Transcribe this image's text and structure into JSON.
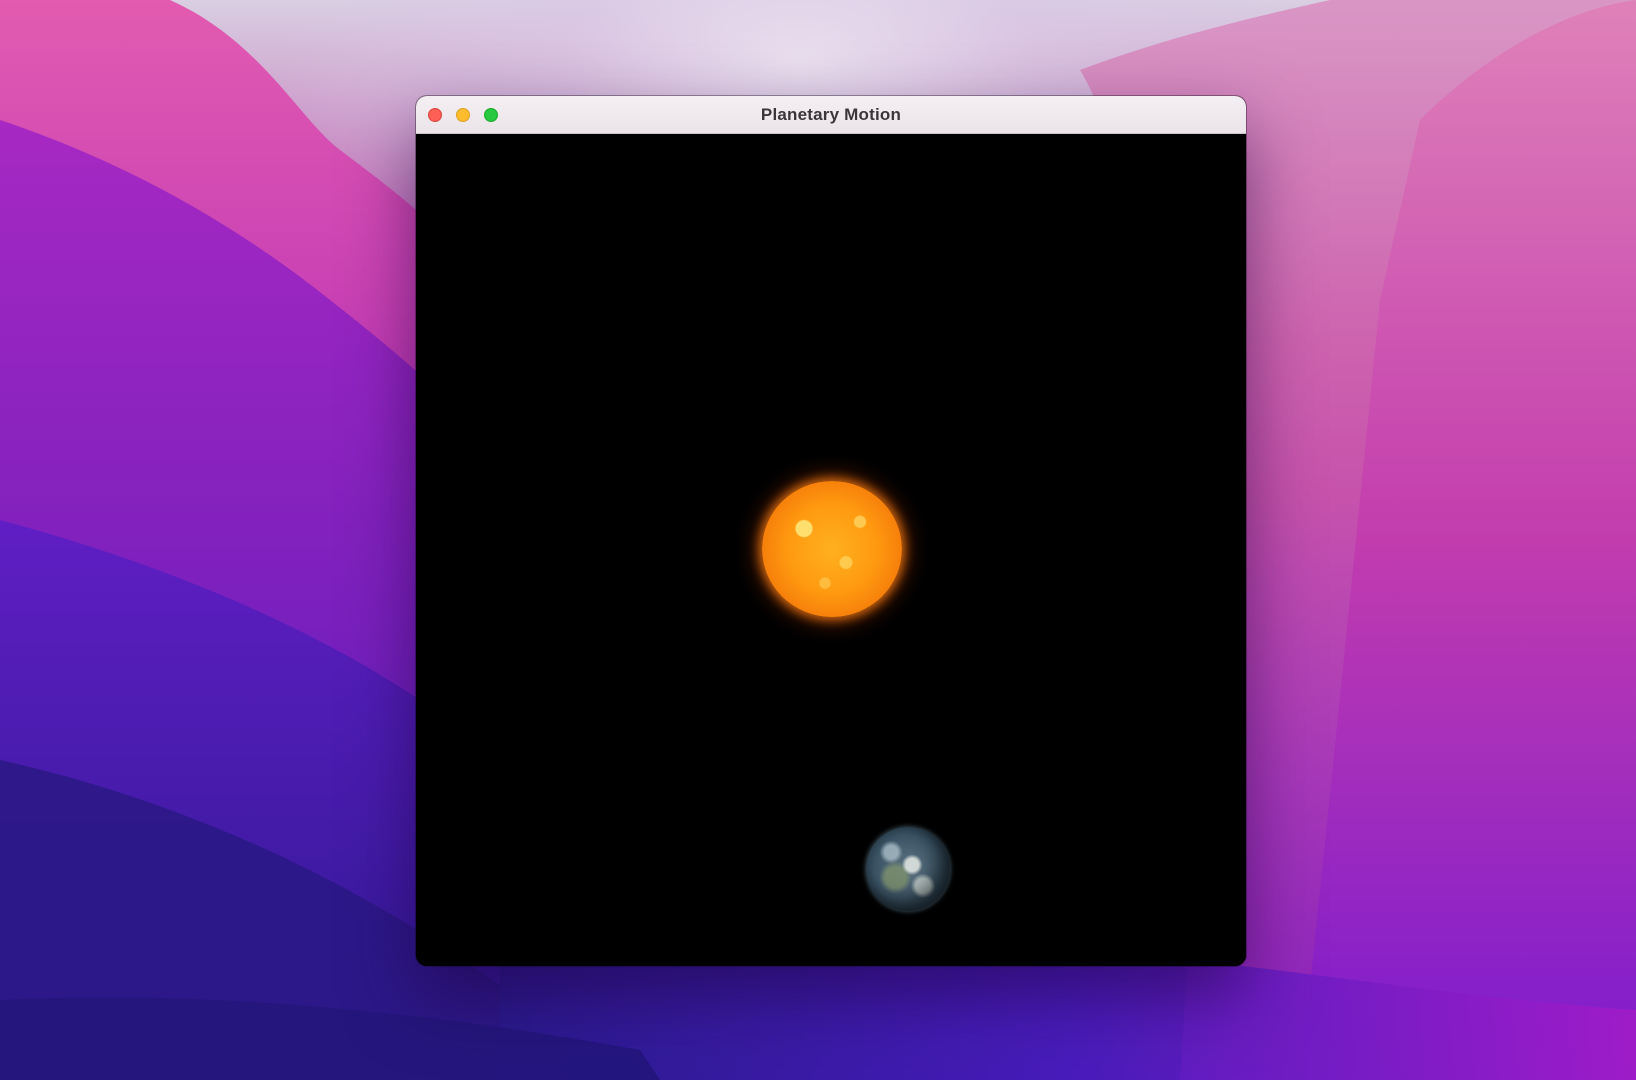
{
  "desktop": {
    "wallpaper": "macOS Monterey wallpaper"
  },
  "window": {
    "title": "Planetary Motion",
    "controls": {
      "close": "close-button",
      "minimize": "minimize-button",
      "zoom": "zoom-button"
    }
  },
  "scene": {
    "background_color": "#000000",
    "bodies": [
      {
        "name": "sun",
        "colors": [
          "#ffb01f",
          "#f57c0a",
          "#b84004"
        ]
      },
      {
        "name": "earth",
        "colors": [
          "#5d7382",
          "#243847",
          "#e6ebe6"
        ]
      }
    ]
  },
  "colors": {
    "traffic_close": "#fe5f57",
    "traffic_minimize": "#febc2e",
    "traffic_zoom": "#28c840",
    "titlebar": "#ebe5ea"
  }
}
